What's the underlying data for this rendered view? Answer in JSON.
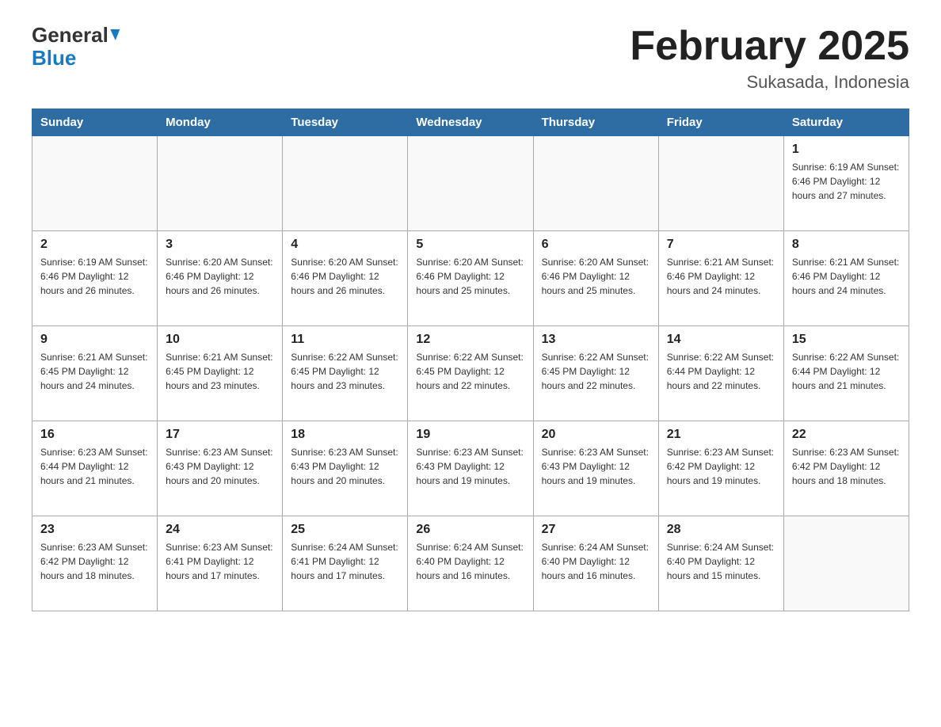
{
  "header": {
    "month_title": "February 2025",
    "location": "Sukasada, Indonesia",
    "logo_general": "General",
    "logo_blue": "Blue"
  },
  "days_of_week": [
    "Sunday",
    "Monday",
    "Tuesday",
    "Wednesday",
    "Thursday",
    "Friday",
    "Saturday"
  ],
  "weeks": [
    [
      {
        "day": "",
        "info": ""
      },
      {
        "day": "",
        "info": ""
      },
      {
        "day": "",
        "info": ""
      },
      {
        "day": "",
        "info": ""
      },
      {
        "day": "",
        "info": ""
      },
      {
        "day": "",
        "info": ""
      },
      {
        "day": "1",
        "info": "Sunrise: 6:19 AM\nSunset: 6:46 PM\nDaylight: 12 hours and 27 minutes."
      }
    ],
    [
      {
        "day": "2",
        "info": "Sunrise: 6:19 AM\nSunset: 6:46 PM\nDaylight: 12 hours and 26 minutes."
      },
      {
        "day": "3",
        "info": "Sunrise: 6:20 AM\nSunset: 6:46 PM\nDaylight: 12 hours and 26 minutes."
      },
      {
        "day": "4",
        "info": "Sunrise: 6:20 AM\nSunset: 6:46 PM\nDaylight: 12 hours and 26 minutes."
      },
      {
        "day": "5",
        "info": "Sunrise: 6:20 AM\nSunset: 6:46 PM\nDaylight: 12 hours and 25 minutes."
      },
      {
        "day": "6",
        "info": "Sunrise: 6:20 AM\nSunset: 6:46 PM\nDaylight: 12 hours and 25 minutes."
      },
      {
        "day": "7",
        "info": "Sunrise: 6:21 AM\nSunset: 6:46 PM\nDaylight: 12 hours and 24 minutes."
      },
      {
        "day": "8",
        "info": "Sunrise: 6:21 AM\nSunset: 6:46 PM\nDaylight: 12 hours and 24 minutes."
      }
    ],
    [
      {
        "day": "9",
        "info": "Sunrise: 6:21 AM\nSunset: 6:45 PM\nDaylight: 12 hours and 24 minutes."
      },
      {
        "day": "10",
        "info": "Sunrise: 6:21 AM\nSunset: 6:45 PM\nDaylight: 12 hours and 23 minutes."
      },
      {
        "day": "11",
        "info": "Sunrise: 6:22 AM\nSunset: 6:45 PM\nDaylight: 12 hours and 23 minutes."
      },
      {
        "day": "12",
        "info": "Sunrise: 6:22 AM\nSunset: 6:45 PM\nDaylight: 12 hours and 22 minutes."
      },
      {
        "day": "13",
        "info": "Sunrise: 6:22 AM\nSunset: 6:45 PM\nDaylight: 12 hours and 22 minutes."
      },
      {
        "day": "14",
        "info": "Sunrise: 6:22 AM\nSunset: 6:44 PM\nDaylight: 12 hours and 22 minutes."
      },
      {
        "day": "15",
        "info": "Sunrise: 6:22 AM\nSunset: 6:44 PM\nDaylight: 12 hours and 21 minutes."
      }
    ],
    [
      {
        "day": "16",
        "info": "Sunrise: 6:23 AM\nSunset: 6:44 PM\nDaylight: 12 hours and 21 minutes."
      },
      {
        "day": "17",
        "info": "Sunrise: 6:23 AM\nSunset: 6:43 PM\nDaylight: 12 hours and 20 minutes."
      },
      {
        "day": "18",
        "info": "Sunrise: 6:23 AM\nSunset: 6:43 PM\nDaylight: 12 hours and 20 minutes."
      },
      {
        "day": "19",
        "info": "Sunrise: 6:23 AM\nSunset: 6:43 PM\nDaylight: 12 hours and 19 minutes."
      },
      {
        "day": "20",
        "info": "Sunrise: 6:23 AM\nSunset: 6:43 PM\nDaylight: 12 hours and 19 minutes."
      },
      {
        "day": "21",
        "info": "Sunrise: 6:23 AM\nSunset: 6:42 PM\nDaylight: 12 hours and 19 minutes."
      },
      {
        "day": "22",
        "info": "Sunrise: 6:23 AM\nSunset: 6:42 PM\nDaylight: 12 hours and 18 minutes."
      }
    ],
    [
      {
        "day": "23",
        "info": "Sunrise: 6:23 AM\nSunset: 6:42 PM\nDaylight: 12 hours and 18 minutes."
      },
      {
        "day": "24",
        "info": "Sunrise: 6:23 AM\nSunset: 6:41 PM\nDaylight: 12 hours and 17 minutes."
      },
      {
        "day": "25",
        "info": "Sunrise: 6:24 AM\nSunset: 6:41 PM\nDaylight: 12 hours and 17 minutes."
      },
      {
        "day": "26",
        "info": "Sunrise: 6:24 AM\nSunset: 6:40 PM\nDaylight: 12 hours and 16 minutes."
      },
      {
        "day": "27",
        "info": "Sunrise: 6:24 AM\nSunset: 6:40 PM\nDaylight: 12 hours and 16 minutes."
      },
      {
        "day": "28",
        "info": "Sunrise: 6:24 AM\nSunset: 6:40 PM\nDaylight: 12 hours and 15 minutes."
      },
      {
        "day": "",
        "info": ""
      }
    ]
  ]
}
